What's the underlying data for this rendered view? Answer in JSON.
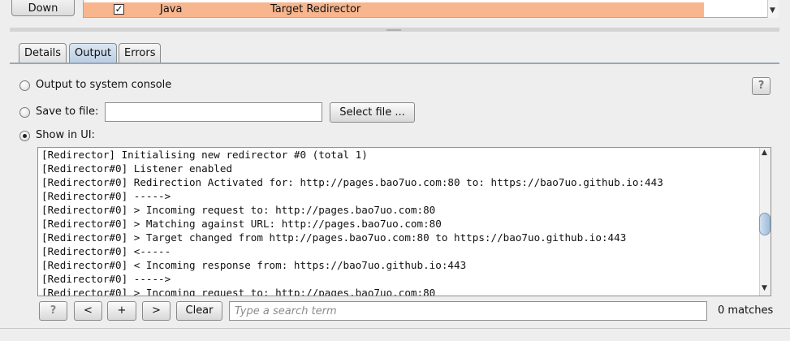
{
  "top_strip": {
    "down_button": "Down",
    "row": {
      "checked": "☑",
      "type": "Java",
      "name": "Target Redirector"
    }
  },
  "tabs": [
    "Details",
    "Output",
    "Errors"
  ],
  "active_tab": "Output",
  "output": {
    "console_label": "Output to system console",
    "file_label": "Save to file:",
    "file_value": "",
    "select_file_button": "Select file ...",
    "show_ui_label": "Show in UI:",
    "selected_option": "Show in UI:",
    "help_icon": "?"
  },
  "log_lines": [
    "[Redirector] Initialising new redirector #0 (total 1)",
    "[Redirector#0] Listener enabled",
    "[Redirector#0] Redirection Activated for: http://pages.bao7uo.com:80 to: https://bao7uo.github.io:443",
    "[Redirector#0] ----->",
    "[Redirector#0] > Incoming request to: http://pages.bao7uo.com:80",
    "[Redirector#0] > Matching against URL: http://pages.bao7uo.com:80",
    "[Redirector#0] > Target changed from http://pages.bao7uo.com:80 to https://bao7uo.github.io:443",
    "[Redirector#0] <-----",
    "[Redirector#0] < Incoming response from: https://bao7uo.github.io:443",
    "[Redirector#0] ----->",
    "[Redirector#0] > Incoming request to: http://pages.bao7uo.com:80"
  ],
  "search": {
    "help": "?",
    "prev": "<",
    "add": "+",
    "next": ">",
    "clear": "Clear",
    "placeholder": "Type a search term",
    "value": "",
    "matches": "0 matches"
  },
  "colors": {
    "highlight_row": "#f8b68e",
    "active_tab": "#c6d8ea"
  }
}
